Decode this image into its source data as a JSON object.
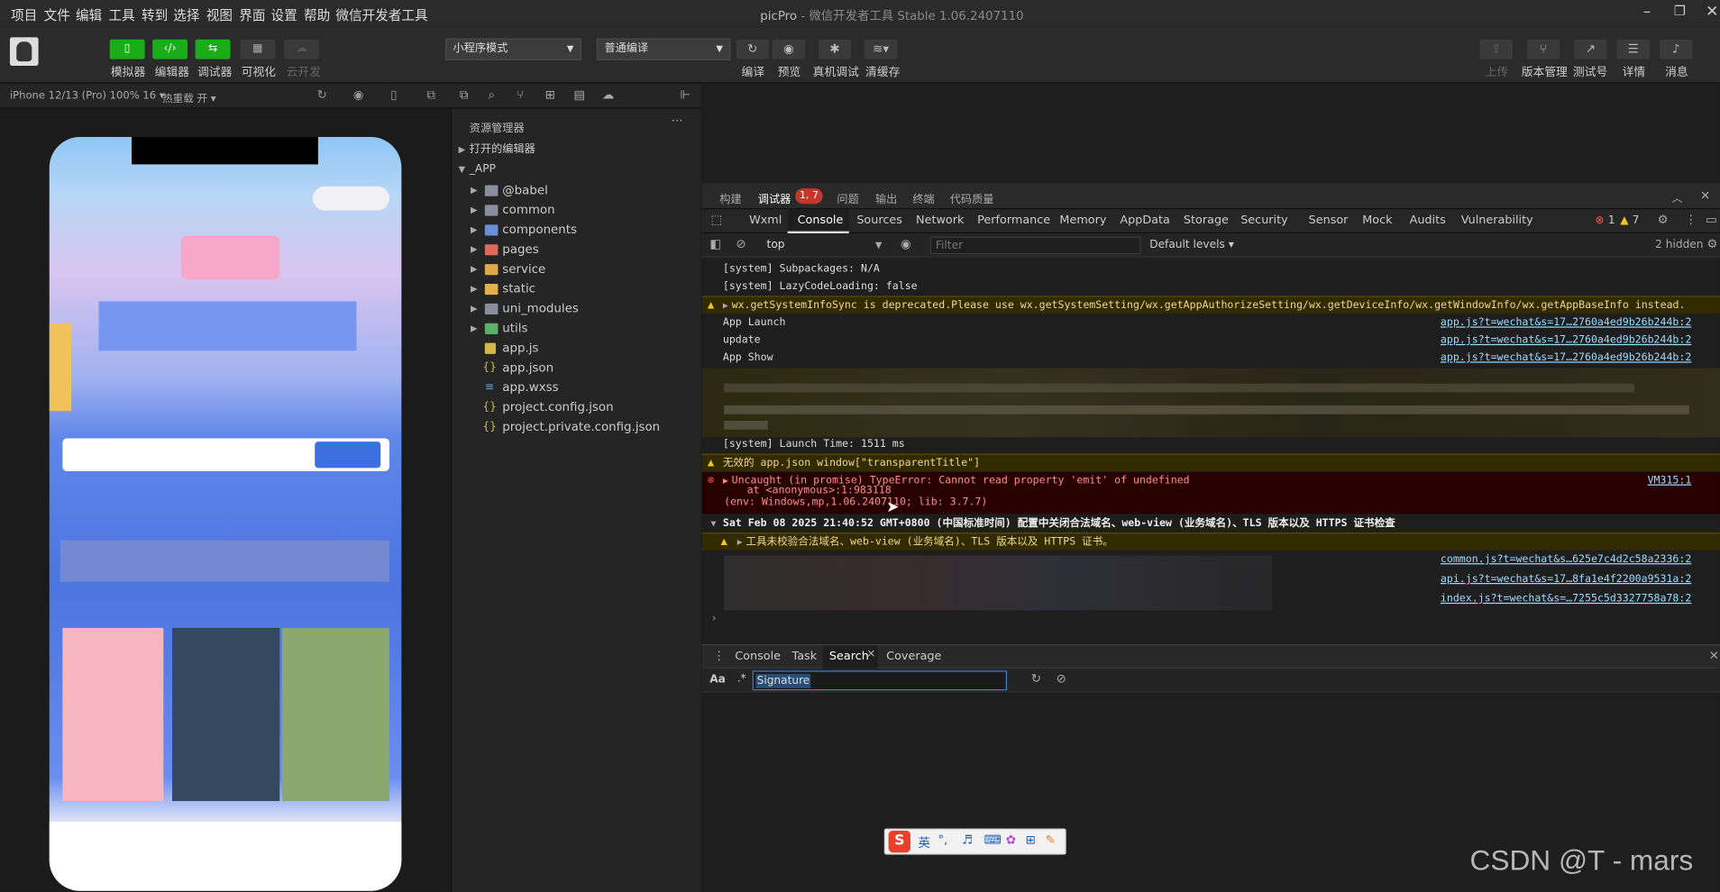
{
  "menubar": {
    "items": [
      "项目",
      "文件",
      "编辑",
      "工具",
      "转到",
      "选择",
      "视图",
      "界面",
      "设置",
      "帮助",
      "微信开发者工具"
    ],
    "title": "picPro",
    "subtitle": " - 微信开发者工具 Stable 1.06.2407110"
  },
  "toolbar": {
    "simulator": "模拟器",
    "editor": "编辑器",
    "debugger": "调试器",
    "visual": "可视化",
    "cloud": "云开发",
    "mode": "小程序模式",
    "compile_mode": "普通编译",
    "compile": "编译",
    "preview": "预览",
    "real_debug": "真机调试",
    "clear_cache": "清缓存",
    "upload": "上传",
    "version": "版本管理",
    "test_account": "测试号",
    "details": "详情",
    "messages": "消息"
  },
  "simbar": {
    "device": "iPhone 12/13 (Pro) 100% 16",
    "hotreload": "热重载 开"
  },
  "explorer": {
    "title": "资源管理器",
    "open_editors": "打开的编辑器",
    "root": "_APP",
    "folders": [
      "@babel",
      "common",
      "components",
      "pages",
      "service",
      "static",
      "uni_modules",
      "utils"
    ],
    "files": [
      {
        "name": "app.js",
        "icon": "js"
      },
      {
        "name": "app.json",
        "icon": "json"
      },
      {
        "name": "app.wxss",
        "icon": "wxss"
      },
      {
        "name": "project.config.json",
        "icon": "json"
      },
      {
        "name": "project.private.config.json",
        "icon": "json"
      }
    ]
  },
  "debugger": {
    "tabs": [
      "构建",
      "调试器",
      "问题",
      "输出",
      "终端",
      "代码质量"
    ],
    "badge": "1, 7",
    "panels": [
      "Wxml",
      "Console",
      "Sources",
      "Network",
      "Performance",
      "Memory",
      "AppData",
      "Storage",
      "Security",
      "Sensor",
      "Mock",
      "Audits",
      "Vulnerability"
    ],
    "err_count": "1",
    "warn_count": "7",
    "context": "top",
    "filter_placeholder": "Filter",
    "levels": "Default levels",
    "hidden": "2 hidden"
  },
  "console": {
    "l1": "[system] Subpackages: N/A",
    "l2": "[system] LazyCodeLoading: false",
    "l3": "wx.getSystemInfoSync is deprecated.Please use wx.getSystemSetting/wx.getAppAuthorizeSetting/wx.getDeviceInfo/wx.getWindowInfo/wx.getAppBaseInfo instead.",
    "l4": "App Launch",
    "l5": "update",
    "l6": "App Show",
    "src1": "app.js?t=wechat&s=17…2760a4ed9b26b244b:2",
    "l7": "[system] Launch Time: 1511 ms",
    "l8": "无效的 app.json window[\"transparentTitle\"]",
    "l9": "Uncaught (in promise) TypeError: Cannot read property 'emit' of undefined",
    "l9b": "at <anonymous>:1:983118",
    "l9c": "(env: Windows,mp,1.06.2407110; lib: 3.7.7)",
    "vm": "VM315:1",
    "l10": "Sat Feb 08 2025 21:40:52 GMT+0800 (中国标准时间) 配置中关闭合法域名、web-view (业务域名)、TLS 版本以及 HTTPS 证书检查",
    "l11": "工具未校验合法域名、web-view (业务域名)、TLS 版本以及 HTTPS 证书。",
    "src2": "common.js?t=wechat&s…625e7c4d2c58a2336:2",
    "src3": "api.js?t=wechat&s=17…8fa1e4f2200a9531a:2",
    "src4": "index.js?t=wechat&s=…7255c5d3327758a78:2",
    "src5": "index.js?t=wechat&s=…7255c5d3327758a78:2",
    "prompt": "›"
  },
  "drawer": {
    "tabs": [
      "Console",
      "Task",
      "Search",
      "Coverage"
    ],
    "aa": "Aa",
    "regex": ".*",
    "search_value": "Signature"
  },
  "watermark": "CSDN @T - mars",
  "ime": "英"
}
